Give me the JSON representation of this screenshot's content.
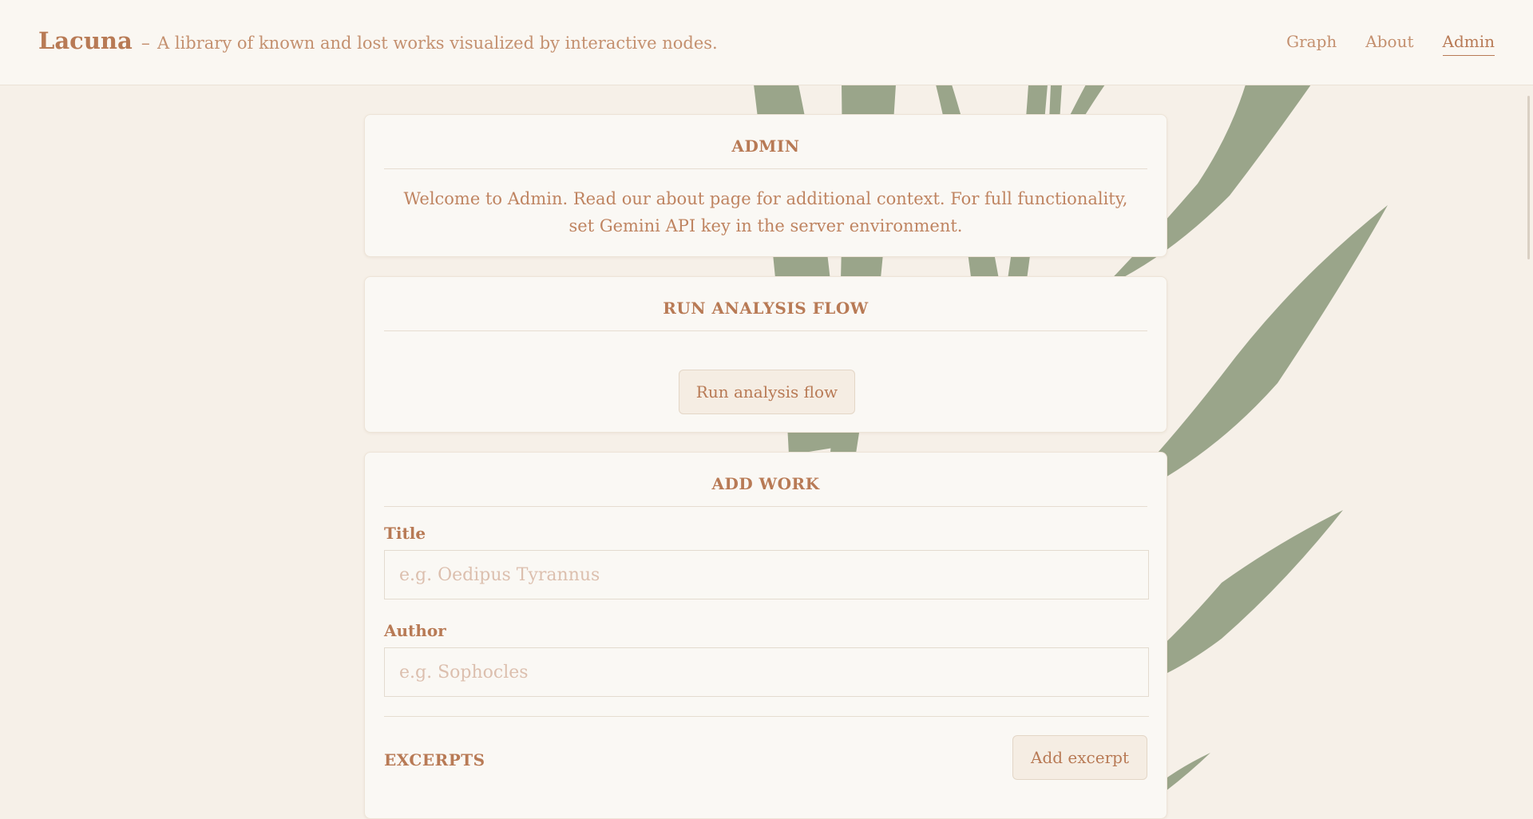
{
  "header": {
    "brand_name": "Lacuna",
    "brand_separator": "–",
    "brand_tagline": "A library of known and lost works visualized by interactive nodes.",
    "nav": [
      {
        "label": "Graph",
        "active": false
      },
      {
        "label": "About",
        "active": false
      },
      {
        "label": "Admin",
        "active": true
      }
    ]
  },
  "admin": {
    "title": "ADMIN",
    "welcome": "Welcome to Admin. Read our about page for additional context. For full functionality, set Gemini API key in the server environment."
  },
  "analysis": {
    "title": "RUN ANALYSIS FLOW",
    "button_label": "Run analysis flow"
  },
  "add_work": {
    "title": "ADD WORK",
    "title_label": "Title",
    "title_placeholder": "e.g. Oedipus Tyrannus",
    "title_value": "",
    "author_label": "Author",
    "author_placeholder": "e.g. Sophocles",
    "author_value": "",
    "excerpts_label": "EXCERPTS",
    "add_excerpt_label": "Add excerpt"
  },
  "colors": {
    "background": "#f6f0e8",
    "card": "#faf8f4",
    "accent": "#b87a55",
    "leaf": "#9aa58a"
  }
}
